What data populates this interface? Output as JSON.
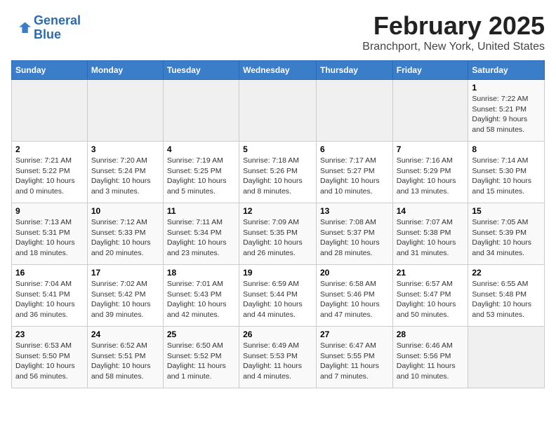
{
  "header": {
    "logo_line1": "General",
    "logo_line2": "Blue",
    "title": "February 2025",
    "subtitle": "Branchport, New York, United States"
  },
  "days_of_week": [
    "Sunday",
    "Monday",
    "Tuesday",
    "Wednesday",
    "Thursday",
    "Friday",
    "Saturday"
  ],
  "weeks": [
    [
      {
        "day": "",
        "info": ""
      },
      {
        "day": "",
        "info": ""
      },
      {
        "day": "",
        "info": ""
      },
      {
        "day": "",
        "info": ""
      },
      {
        "day": "",
        "info": ""
      },
      {
        "day": "",
        "info": ""
      },
      {
        "day": "1",
        "info": "Sunrise: 7:22 AM\nSunset: 5:21 PM\nDaylight: 9 hours and 58 minutes."
      }
    ],
    [
      {
        "day": "2",
        "info": "Sunrise: 7:21 AM\nSunset: 5:22 PM\nDaylight: 10 hours and 0 minutes."
      },
      {
        "day": "3",
        "info": "Sunrise: 7:20 AM\nSunset: 5:24 PM\nDaylight: 10 hours and 3 minutes."
      },
      {
        "day": "4",
        "info": "Sunrise: 7:19 AM\nSunset: 5:25 PM\nDaylight: 10 hours and 5 minutes."
      },
      {
        "day": "5",
        "info": "Sunrise: 7:18 AM\nSunset: 5:26 PM\nDaylight: 10 hours and 8 minutes."
      },
      {
        "day": "6",
        "info": "Sunrise: 7:17 AM\nSunset: 5:27 PM\nDaylight: 10 hours and 10 minutes."
      },
      {
        "day": "7",
        "info": "Sunrise: 7:16 AM\nSunset: 5:29 PM\nDaylight: 10 hours and 13 minutes."
      },
      {
        "day": "8",
        "info": "Sunrise: 7:14 AM\nSunset: 5:30 PM\nDaylight: 10 hours and 15 minutes."
      }
    ],
    [
      {
        "day": "9",
        "info": "Sunrise: 7:13 AM\nSunset: 5:31 PM\nDaylight: 10 hours and 18 minutes."
      },
      {
        "day": "10",
        "info": "Sunrise: 7:12 AM\nSunset: 5:33 PM\nDaylight: 10 hours and 20 minutes."
      },
      {
        "day": "11",
        "info": "Sunrise: 7:11 AM\nSunset: 5:34 PM\nDaylight: 10 hours and 23 minutes."
      },
      {
        "day": "12",
        "info": "Sunrise: 7:09 AM\nSunset: 5:35 PM\nDaylight: 10 hours and 26 minutes."
      },
      {
        "day": "13",
        "info": "Sunrise: 7:08 AM\nSunset: 5:37 PM\nDaylight: 10 hours and 28 minutes."
      },
      {
        "day": "14",
        "info": "Sunrise: 7:07 AM\nSunset: 5:38 PM\nDaylight: 10 hours and 31 minutes."
      },
      {
        "day": "15",
        "info": "Sunrise: 7:05 AM\nSunset: 5:39 PM\nDaylight: 10 hours and 34 minutes."
      }
    ],
    [
      {
        "day": "16",
        "info": "Sunrise: 7:04 AM\nSunset: 5:41 PM\nDaylight: 10 hours and 36 minutes."
      },
      {
        "day": "17",
        "info": "Sunrise: 7:02 AM\nSunset: 5:42 PM\nDaylight: 10 hours and 39 minutes."
      },
      {
        "day": "18",
        "info": "Sunrise: 7:01 AM\nSunset: 5:43 PM\nDaylight: 10 hours and 42 minutes."
      },
      {
        "day": "19",
        "info": "Sunrise: 6:59 AM\nSunset: 5:44 PM\nDaylight: 10 hours and 44 minutes."
      },
      {
        "day": "20",
        "info": "Sunrise: 6:58 AM\nSunset: 5:46 PM\nDaylight: 10 hours and 47 minutes."
      },
      {
        "day": "21",
        "info": "Sunrise: 6:57 AM\nSunset: 5:47 PM\nDaylight: 10 hours and 50 minutes."
      },
      {
        "day": "22",
        "info": "Sunrise: 6:55 AM\nSunset: 5:48 PM\nDaylight: 10 hours and 53 minutes."
      }
    ],
    [
      {
        "day": "23",
        "info": "Sunrise: 6:53 AM\nSunset: 5:50 PM\nDaylight: 10 hours and 56 minutes."
      },
      {
        "day": "24",
        "info": "Sunrise: 6:52 AM\nSunset: 5:51 PM\nDaylight: 10 hours and 58 minutes."
      },
      {
        "day": "25",
        "info": "Sunrise: 6:50 AM\nSunset: 5:52 PM\nDaylight: 11 hours and 1 minute."
      },
      {
        "day": "26",
        "info": "Sunrise: 6:49 AM\nSunset: 5:53 PM\nDaylight: 11 hours and 4 minutes."
      },
      {
        "day": "27",
        "info": "Sunrise: 6:47 AM\nSunset: 5:55 PM\nDaylight: 11 hours and 7 minutes."
      },
      {
        "day": "28",
        "info": "Sunrise: 6:46 AM\nSunset: 5:56 PM\nDaylight: 11 hours and 10 minutes."
      },
      {
        "day": "",
        "info": ""
      }
    ]
  ]
}
